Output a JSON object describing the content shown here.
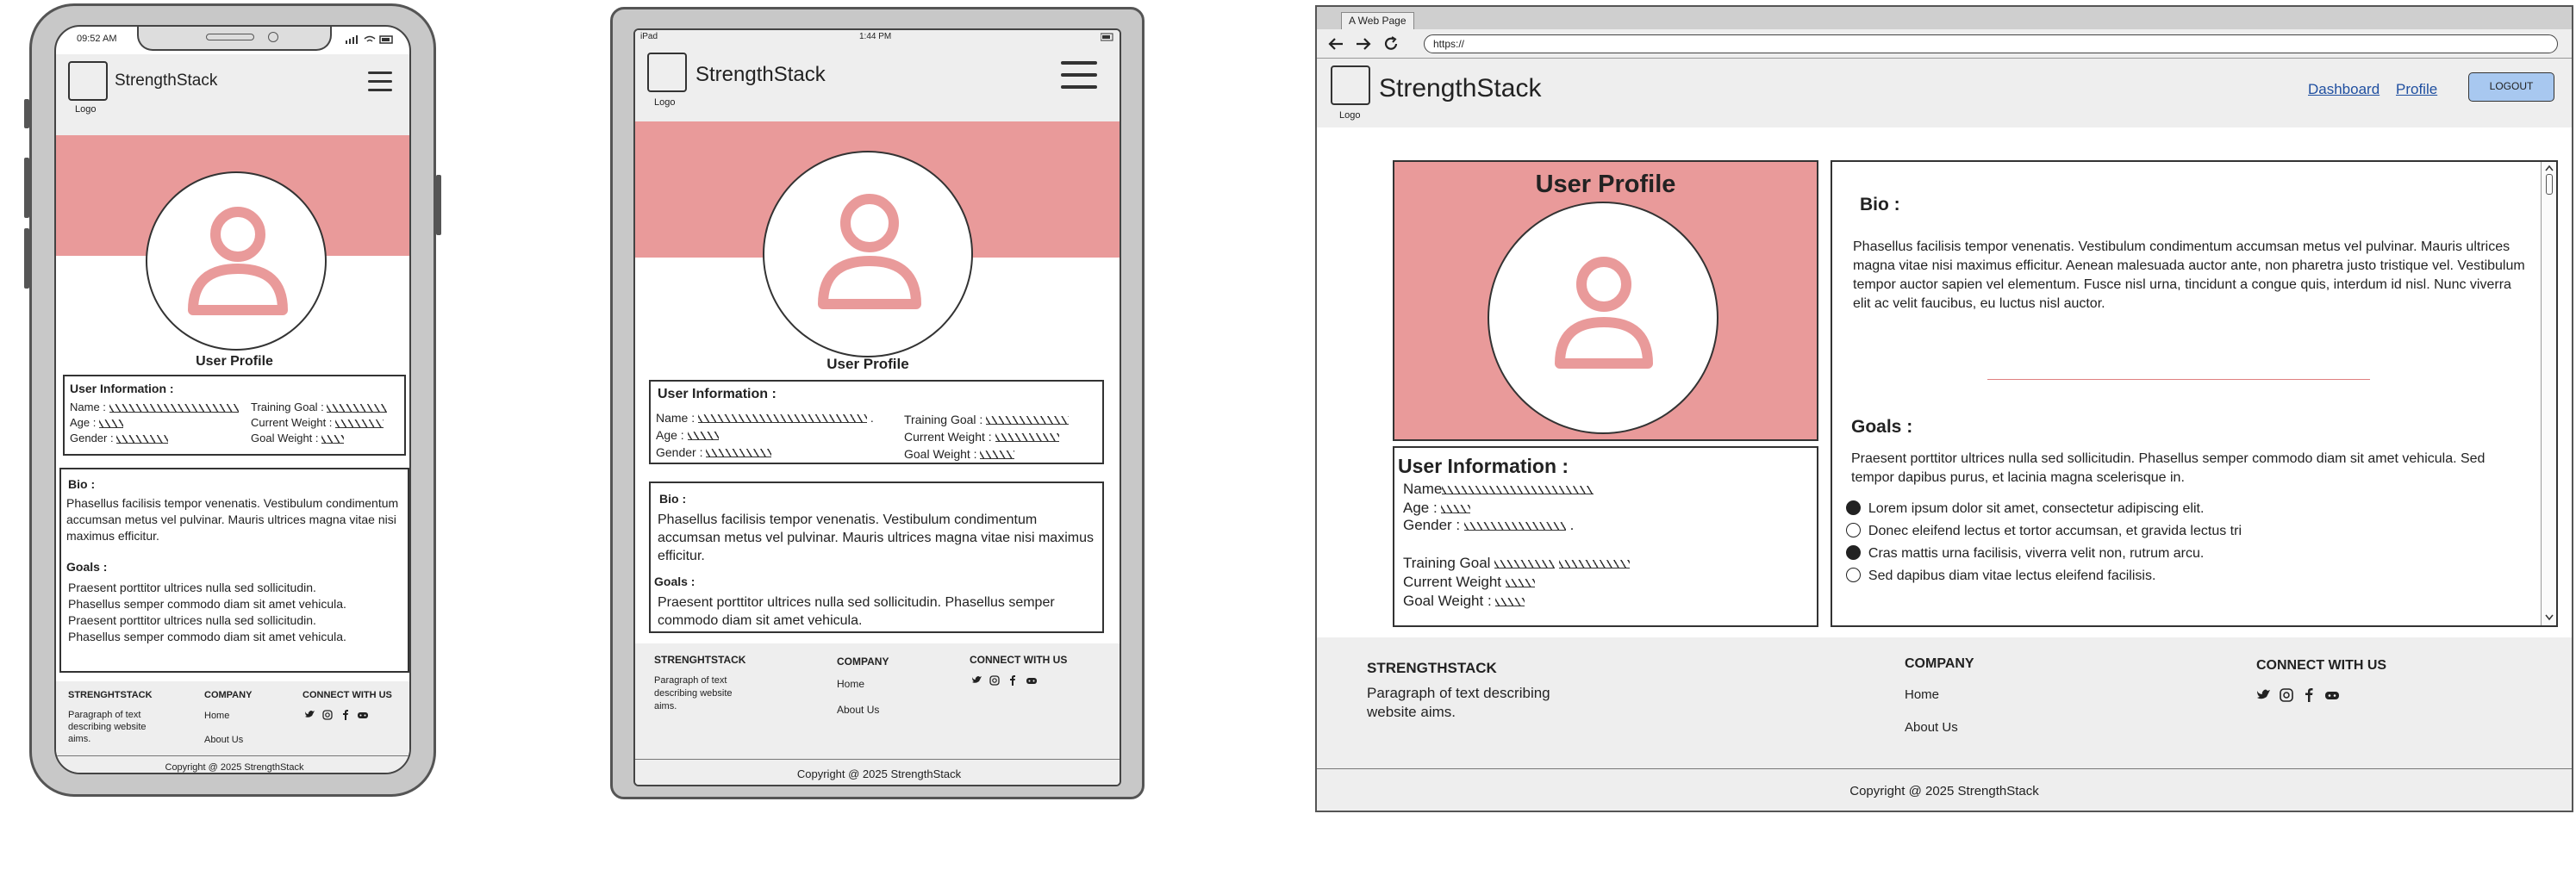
{
  "brand": "StrengthStack",
  "logo_label": "Logo",
  "profile_title": "User Profile",
  "user_info": {
    "heading": "User Information :",
    "name": "Name :",
    "name_plain": "Name",
    "age": "Age :",
    "gender": "Gender :",
    "training_goal": "Training Goal :",
    "training_goal_plain": "Training Goal",
    "current_weight": "Current Weight :",
    "current_weight_plain": "Current Weight",
    "goal_weight": "Goal Weight :"
  },
  "bio": {
    "heading": "Bio :",
    "text": "Phasellus facilisis tempor venenatis. Vestibulum condimentum accumsan metus vel pulvinar. Mauris ultrices magna vitae nisi maximus efficitur.",
    "text_long": "Phasellus facilisis tempor venenatis. Vestibulum condimentum accumsan metus vel pulvinar. Mauris ultrices magna vitae nisi maximus efficitur. Aenean malesuada auctor ante, non pharetra justo tristique vel. Vestibulum tempor auctor sapien vel elementum. Fusce nisl urna, tincidunt a congue quis, interdum id nisl. Nunc viverra elit ac velit faucibus, eu luctus nisl auctor."
  },
  "goals": {
    "heading": "Goals :",
    "phone_lines": [
      "Praesent porttitor ultrices nulla sed sollicitudin.",
      "Phasellus semper commodo diam sit amet vehicula.",
      "Praesent porttitor ultrices nulla sed sollicitudin.",
      "Phasellus semper commodo diam sit amet vehicula."
    ],
    "tablet_text": "Praesent porttitor ultrices nulla sed sollicitudin. Phasellus semper commodo diam sit amet vehicula.",
    "desktop_text": "Praesent porttitor ultrices nulla sed sollicitudin. Phasellus semper commodo diam sit amet vehicula. Sed tempor dapibus purus, et lacinia magna scelerisque in.",
    "options": [
      {
        "label": "Lorem ipsum dolor sit amet, consectetur adipiscing elit.",
        "selected": true
      },
      {
        "label": "Donec eleifend lectus et tortor accumsan, et gravida lectus tri",
        "selected": false
      },
      {
        "label": "Cras mattis urna facilisis, viverra velit non, rutrum arcu.",
        "selected": true
      },
      {
        "label": "Sed dapibus diam vitae lectus eleifend facilisis.",
        "selected": false
      }
    ]
  },
  "footer": {
    "brand_heading": "STRENGHTSTACK",
    "brand_heading_desktop": "STRENGTHSTACK",
    "description": "Paragraph of text describing website aims.",
    "company_heading": "COMPANY",
    "links": [
      "Home",
      "About Us"
    ],
    "connect_heading": "CONNECT WITH US",
    "social_icons": [
      "twitter-icon",
      "instagram-icon",
      "facebook-icon",
      "discord-icon"
    ],
    "copyright": "Copyright @ 2025 StrengthStack"
  },
  "phone": {
    "time": "09:52 AM"
  },
  "tablet": {
    "device": "iPad",
    "time": "1:44 PM"
  },
  "browser": {
    "tab_title": "A Web Page",
    "url": "https://",
    "nav": [
      "Dashboard",
      "Profile"
    ],
    "logout": "LOGOUT"
  },
  "colors": {
    "hero": "#e99a9a",
    "accent_button": "#a8c8f0",
    "link": "#1f4fa0"
  }
}
